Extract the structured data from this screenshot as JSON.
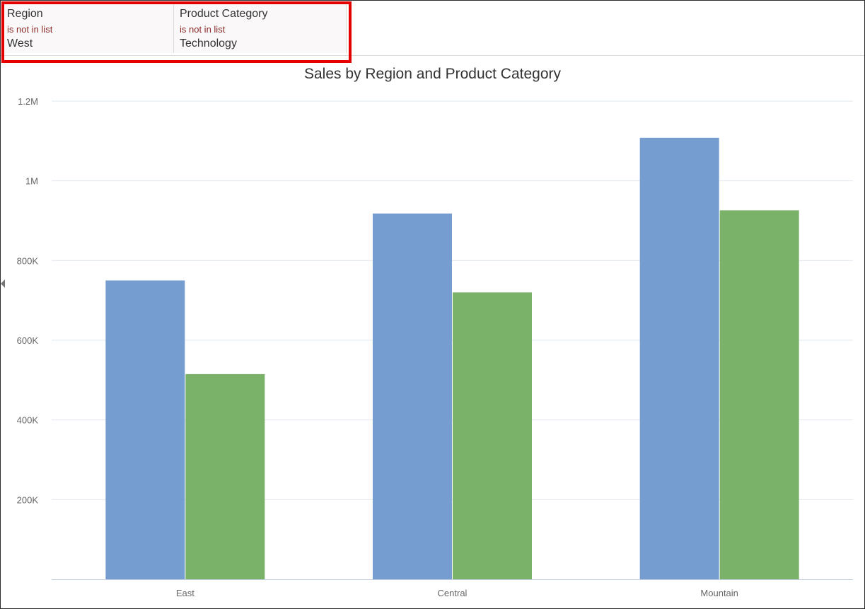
{
  "filters": [
    {
      "label": "Region",
      "operator": "is not in list",
      "value": "West"
    },
    {
      "label": "Product Category",
      "operator": "is not in list",
      "value": "Technology"
    }
  ],
  "colors": {
    "series_1": "#759dd0",
    "series_2": "#7ab26a",
    "highlight": "#e50000"
  },
  "chart_data": {
    "type": "bar",
    "title": "Sales by Region and Product Category",
    "xlabel": "",
    "ylabel": "",
    "categories": [
      "East",
      "Central",
      "Mountain"
    ],
    "series": [
      {
        "values": [
          750000,
          918000,
          1108000
        ]
      },
      {
        "values": [
          515000,
          720000,
          926000
        ]
      }
    ],
    "ylim": [
      0,
      1200000
    ],
    "yticks": [
      {
        "value": 200000,
        "label": "200K"
      },
      {
        "value": 400000,
        "label": "400K"
      },
      {
        "value": 600000,
        "label": "600K"
      },
      {
        "value": 800000,
        "label": "800K"
      },
      {
        "value": 1000000,
        "label": "1M"
      },
      {
        "value": 1200000,
        "label": "1.2M"
      }
    ],
    "grid": true,
    "legend": "none"
  }
}
